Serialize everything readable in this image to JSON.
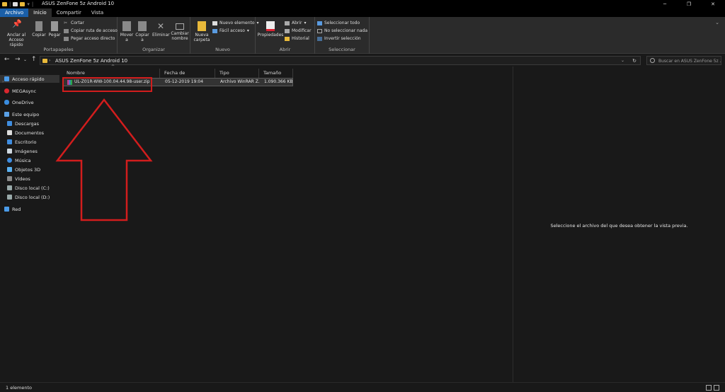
{
  "window": {
    "title": "ASUS ZenFone 5z Android 10",
    "controls": {
      "minimize": "─",
      "maximize": "❐",
      "close": "✕"
    }
  },
  "tabs": [
    "Archivo",
    "Inicio",
    "Compartir",
    "Vista"
  ],
  "ribbon": {
    "portapapeles": {
      "label": "Portapapeles",
      "anclar": "Anclar al Acceso rápido",
      "copiar": "Copiar",
      "pegar": "Pegar",
      "cortar": "Cortar",
      "copiar_ruta": "Copiar ruta de acceso",
      "pegar_acceso": "Pegar acceso directo"
    },
    "organizar": {
      "label": "Organizar",
      "mover": "Mover a",
      "copiar": "Copiar a",
      "eliminar": "Eliminar",
      "cambiar": "Cambiar nombre"
    },
    "nuevo": {
      "label": "Nuevo",
      "nueva_carpeta": "Nueva carpeta",
      "nuevo_elemento": "Nuevo elemento",
      "facil_acceso": "Fácil acceso"
    },
    "abrir": {
      "label": "Abrir",
      "propiedades": "Propiedades",
      "abrir": "Abrir",
      "modificar": "Modificar",
      "historial": "Historial"
    },
    "seleccionar": {
      "label": "Seleccionar",
      "todo": "Seleccionar todo",
      "nada": "No seleccionar nada",
      "invertir": "Invertir selección"
    }
  },
  "address": {
    "path": "ASUS ZenFone 5z Android 10",
    "search_placeholder": "Buscar en ASUS ZenFone 5z ..."
  },
  "nav": {
    "acceso_rapido": "Acceso rápido",
    "megasync": "MEGAsync",
    "onedrive": "OneDrive",
    "este_equipo": "Este equipo",
    "descargas": "Descargas",
    "documentos": "Documentos",
    "escritorio": "Escritorio",
    "imagenes": "Imágenes",
    "musica": "Música",
    "objetos3d": "Objetos 3D",
    "videos": "Vídeos",
    "disco_c": "Disco local (C:)",
    "disco_d": "Disco local (D:)",
    "red": "Red"
  },
  "columns": {
    "nombre": "Nombre",
    "fecha": "Fecha de modificación",
    "tipo": "Tipo",
    "tamano": "Tamaño"
  },
  "files": [
    {
      "name": "UL-Z01R-WW-100.04.44.98-user.zip",
      "date": "05-12-2019 19:04",
      "type": "Archivo WinRAR Z...",
      "size": "1.090.366 KB"
    }
  ],
  "preview": {
    "message": "Seleccione el archivo del que desea obtener la vista previa."
  },
  "status": {
    "count": "1 elemento"
  },
  "colors": {
    "accent": "#1a5fa8",
    "highlight": "#d21d1d",
    "background": "#191919",
    "ribbon": "#2b2b2b"
  }
}
